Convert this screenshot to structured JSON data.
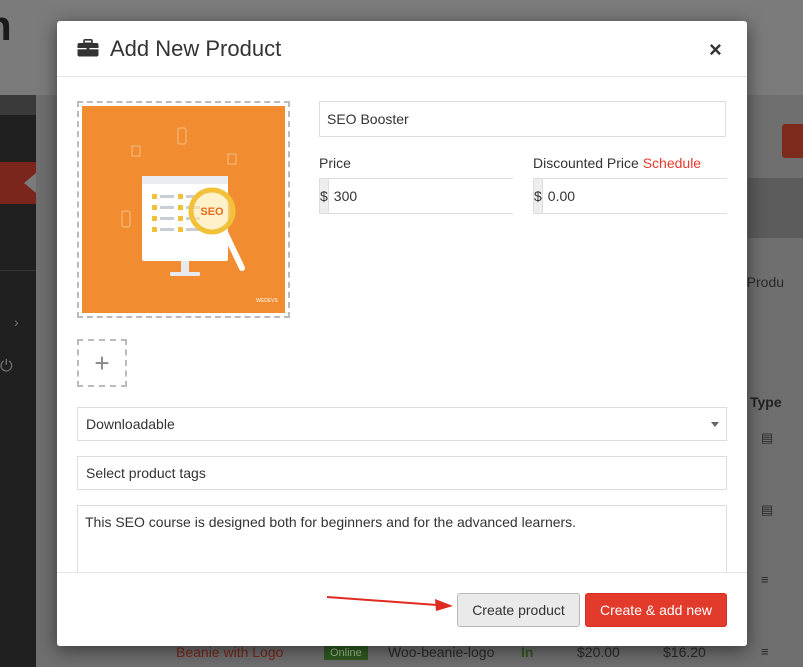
{
  "background": {
    "logo_text": "n",
    "column_header": "Type",
    "partial_text": "h Produ",
    "row": {
      "name": "Beanie with Logo",
      "status": "Online",
      "sku": "Woo-beanie-logo",
      "stock": "In",
      "price": "$20.00",
      "price2": "$16.20"
    },
    "icons": [
      "calendar-icon",
      "calendar-icon",
      "menu-icon",
      "menu-icon",
      "chevron-right-icon",
      "power-icon"
    ]
  },
  "modal": {
    "title": "Add New Product",
    "header_icon": "briefcase-icon",
    "close_symbol": "×",
    "image": {
      "badge_text": "SEO",
      "brand_text": "WEDEVS"
    },
    "add_image_symbol": "+",
    "name_value": "SEO Booster",
    "price": {
      "label": "Price",
      "currency": "$",
      "value": "300"
    },
    "discounted": {
      "label": "Discounted Price",
      "schedule_link": "Schedule",
      "currency": "$",
      "value": "0.00"
    },
    "product_type": "Downloadable",
    "tags_placeholder": "Select product tags",
    "description": "This SEO course is designed both for beginners and for the advanced learners.",
    "buttons": {
      "create": "Create product",
      "create_add": "Create & add new"
    }
  },
  "colors": {
    "accent_red": "#e23a2b",
    "schedule_link": "#e53b2c",
    "image_orange": "#f0852c",
    "arrow_red": "#e02b20"
  }
}
